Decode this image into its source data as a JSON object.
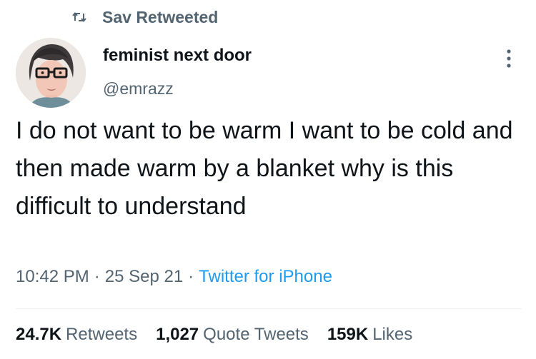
{
  "retweet_context": {
    "icon": "retweet-icon",
    "label": "Sav Retweeted"
  },
  "author": {
    "display_name": "feminist next door",
    "handle": "@emrazz",
    "avatar_icon": "avatar-photo"
  },
  "more_icon": "more-options-icon",
  "tweet": {
    "text": "I do not want to be warm I want to be cold and then made warm by a blanket why is this difficult to understand"
  },
  "meta": {
    "time": "10:42 PM",
    "separator_1": "·",
    "date": "25 Sep 21",
    "separator_2": "·",
    "source": "Twitter for iPhone"
  },
  "stats": {
    "retweets_count": "24.7K",
    "retweets_label": "Retweets",
    "quotes_count": "1,027",
    "quotes_label": "Quote Tweets",
    "likes_count": "159K",
    "likes_label": "Likes"
  },
  "colors": {
    "text_primary": "#0f1419",
    "text_secondary": "#536471",
    "link": "#1d9bf0",
    "divider": "#eff3f4"
  }
}
